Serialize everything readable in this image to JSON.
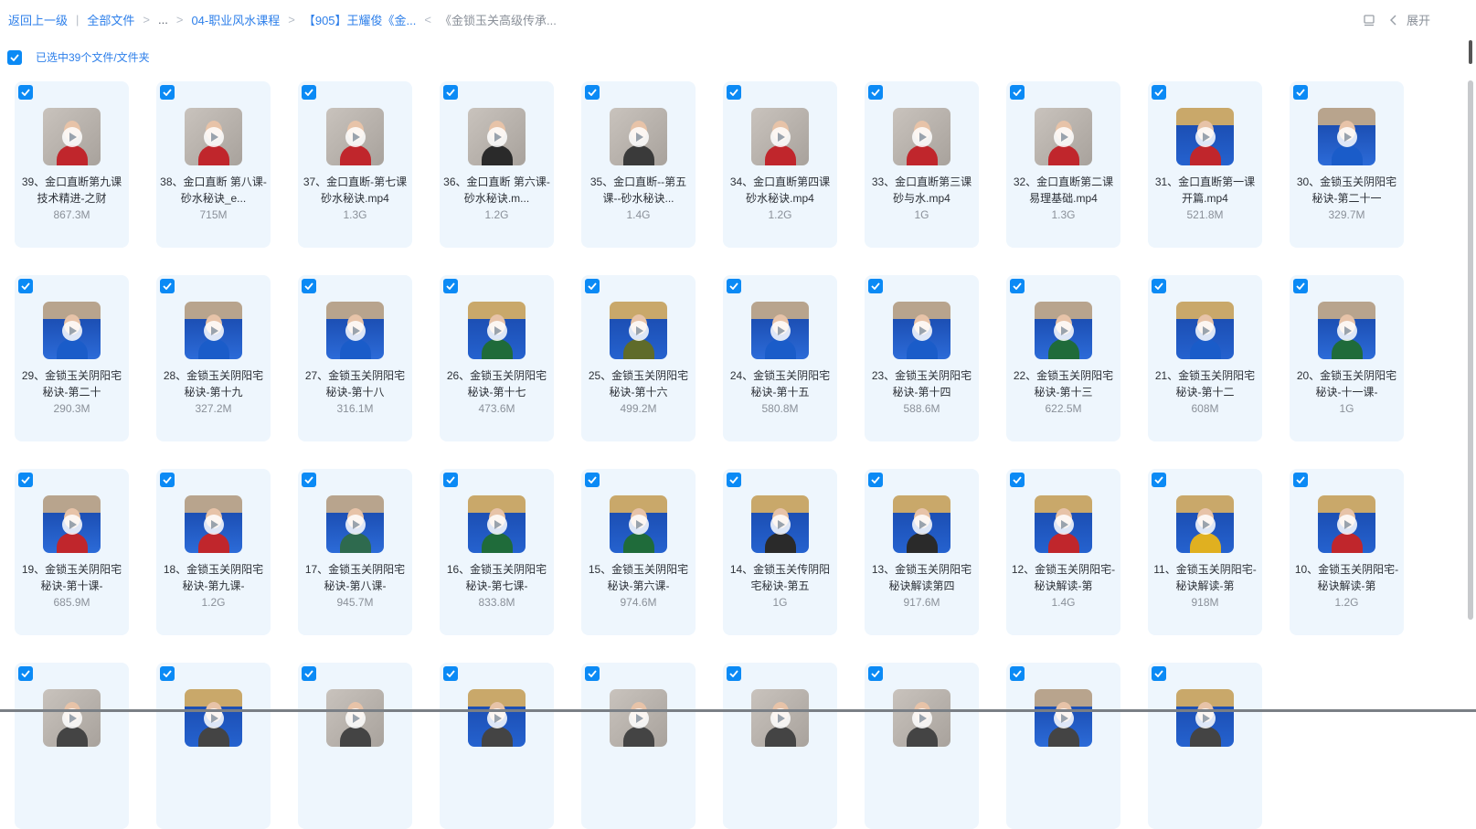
{
  "breadcrumb": {
    "back": "返回上一级",
    "root": "全部文件",
    "ellipsis": "...",
    "level1": "04-职业风水课程",
    "level2": "【905】王耀俊《金...",
    "current": "《金锁玉关高级传承..."
  },
  "toolbar": {
    "expand_label": "展开",
    "layout_icon": "layout-toggle-icon"
  },
  "selection": {
    "label": "已选中39个文件/文件夹"
  },
  "colors": {
    "accent": "#0b8af5",
    "link": "#2d7fea",
    "card_bg": "#eef6fd"
  },
  "files": [
    {
      "name": "39、金口直断第九课技术精进-之财",
      "size": "867.3M",
      "thumb": "room",
      "shirt": "#c0262c"
    },
    {
      "name": "38、金口直断 第八课-砂水秘诀_e...",
      "size": "715M",
      "thumb": "room",
      "shirt": "#c0262c"
    },
    {
      "name": "37、金口直断-第七课砂水秘诀.mp4",
      "size": "1.3G",
      "thumb": "room",
      "shirt": "#c0262c"
    },
    {
      "name": "36、金口直断 第六课-砂水秘诀.m...",
      "size": "1.2G",
      "thumb": "room",
      "shirt": "#2a2a2a"
    },
    {
      "name": "35、金口直断--第五课--砂水秘诀...",
      "size": "1.4G",
      "thumb": "room",
      "shirt": "#3a3a3a"
    },
    {
      "name": "34、金口直断第四课砂水秘诀.mp4",
      "size": "1.2G",
      "thumb": "room",
      "shirt": "#c0262c"
    },
    {
      "name": "33、金口直断第三课砂与水.mp4",
      "size": "1G",
      "thumb": "room",
      "shirt": "#c0262c"
    },
    {
      "name": "32、金口直断第二课易理基础.mp4",
      "size": "1.3G",
      "thumb": "room",
      "shirt": "#c0262c"
    },
    {
      "name": "31、金口直断第一课开篇.mp4",
      "size": "521.8M",
      "thumb": "warm",
      "shirt": "#c0262c"
    },
    {
      "name": "30、金锁玉关阴阳宅秘诀-第二十一",
      "size": "329.7M",
      "thumb": "board",
      "shirt": "#1a5cc9"
    },
    {
      "name": "29、金锁玉关阴阳宅秘诀-第二十",
      "size": "290.3M",
      "thumb": "board",
      "shirt": "#1a5cc9"
    },
    {
      "name": "28、金锁玉关阴阳宅秘诀-第十九",
      "size": "327.2M",
      "thumb": "board",
      "shirt": "#1a5cc9"
    },
    {
      "name": "27、金锁玉关阴阳宅秘诀-第十八",
      "size": "316.1M",
      "thumb": "board",
      "shirt": "#1a5cc9"
    },
    {
      "name": "26、金锁玉关阴阳宅秘诀-第十七",
      "size": "473.6M",
      "thumb": "warm",
      "shirt": "#1f6b3a"
    },
    {
      "name": "25、金锁玉关阴阳宅秘诀-第十六",
      "size": "499.2M",
      "thumb": "warm",
      "shirt": "#5f6b2a"
    },
    {
      "name": "24、金锁玉关阴阳宅秘诀-第十五",
      "size": "580.8M",
      "thumb": "board",
      "shirt": "#1a5cc9"
    },
    {
      "name": "23、金锁玉关阴阳宅秘诀-第十四",
      "size": "588.6M",
      "thumb": "board",
      "shirt": "#1a5cc9"
    },
    {
      "name": "22、金锁玉关阴阳宅秘诀-第十三",
      "size": "622.5M",
      "thumb": "board",
      "shirt": "#1f6b3a"
    },
    {
      "name": "21、金锁玉关阴阳宅秘诀-第十二",
      "size": "608M",
      "thumb": "warm",
      "shirt": "#1a5cc9"
    },
    {
      "name": "20、金锁玉关阴阳宅秘诀-十一课-",
      "size": "1G",
      "thumb": "board",
      "shirt": "#1f6b3a"
    },
    {
      "name": "19、金锁玉关阴阳宅秘诀-第十课-",
      "size": "685.9M",
      "thumb": "board",
      "shirt": "#c0262c"
    },
    {
      "name": "18、金锁玉关阴阳宅秘诀-第九课-",
      "size": "1.2G",
      "thumb": "board",
      "shirt": "#c0262c"
    },
    {
      "name": "17、金锁玉关阴阳宅秘诀-第八课-",
      "size": "945.7M",
      "thumb": "board",
      "shirt": "#2e6a4e"
    },
    {
      "name": "16、金锁玉关阴阳宅秘诀-第七课-",
      "size": "833.8M",
      "thumb": "warm",
      "shirt": "#1f6b3a"
    },
    {
      "name": "15、金锁玉关阴阳宅秘诀-第六课-",
      "size": "974.6M",
      "thumb": "warm",
      "shirt": "#1f6b3a"
    },
    {
      "name": "14、金锁玉关传阴阳宅秘诀-第五",
      "size": "1G",
      "thumb": "warm",
      "shirt": "#2a2a2a"
    },
    {
      "name": "13、金锁玉关阴阳宅秘诀解读第四",
      "size": "917.6M",
      "thumb": "warm",
      "shirt": "#2a2a2a"
    },
    {
      "name": "12、金锁玉关阴阳宅-秘诀解读-第",
      "size": "1.4G",
      "thumb": "warm",
      "shirt": "#c0262c"
    },
    {
      "name": "11、金锁玉关阴阳宅-秘诀解读-第",
      "size": "918M",
      "thumb": "warm",
      "shirt": "#e0b020"
    },
    {
      "name": "10、金锁玉关阴阳宅-秘诀解读-第",
      "size": "1.2G",
      "thumb": "warm",
      "shirt": "#c0262c"
    },
    {
      "name": "",
      "size": "",
      "thumb": "room",
      "shirt": "#444"
    },
    {
      "name": "",
      "size": "",
      "thumb": "warm",
      "shirt": "#444"
    },
    {
      "name": "",
      "size": "",
      "thumb": "room",
      "shirt": "#444"
    },
    {
      "name": "",
      "size": "",
      "thumb": "warm",
      "shirt": "#444"
    },
    {
      "name": "",
      "size": "",
      "thumb": "room",
      "shirt": "#444"
    },
    {
      "name": "",
      "size": "",
      "thumb": "room",
      "shirt": "#444"
    },
    {
      "name": "",
      "size": "",
      "thumb": "room",
      "shirt": "#444"
    },
    {
      "name": "",
      "size": "",
      "thumb": "board",
      "shirt": "#444"
    },
    {
      "name": "",
      "size": "",
      "thumb": "warm",
      "shirt": "#444"
    }
  ]
}
